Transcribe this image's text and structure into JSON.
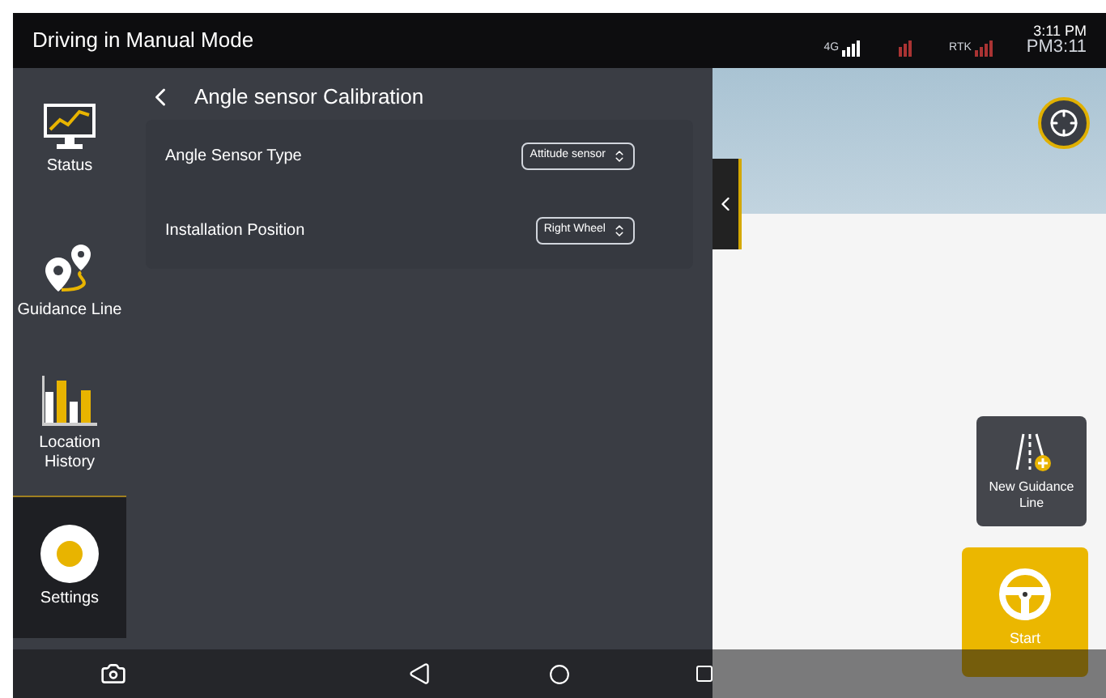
{
  "status_bar": {
    "title": "Driving in Manual Mode",
    "network": "4G",
    "rtk": "RTK",
    "time": "3:11 PM",
    "time_alt": "PM3:11"
  },
  "sidebar": {
    "items": [
      {
        "label": "Status",
        "kind": "status",
        "selected": false
      },
      {
        "label": "Guidance Line",
        "kind": "guidance",
        "selected": false
      },
      {
        "label": "Location History",
        "kind": "history",
        "selected": false
      },
      {
        "label": "Settings",
        "kind": "settings",
        "selected": true
      }
    ]
  },
  "page": {
    "title": "Angle sensor Calibration",
    "rows": [
      {
        "label": "Angle Sensor Type",
        "value": "Attitude sensor"
      },
      {
        "label": "Installation Position",
        "value": "Right Wheel"
      }
    ]
  },
  "map": {
    "buttons": [
      {
        "label": "New Guidance Line",
        "kind": "new-line"
      },
      {
        "label": "Start",
        "kind": "start"
      }
    ]
  }
}
